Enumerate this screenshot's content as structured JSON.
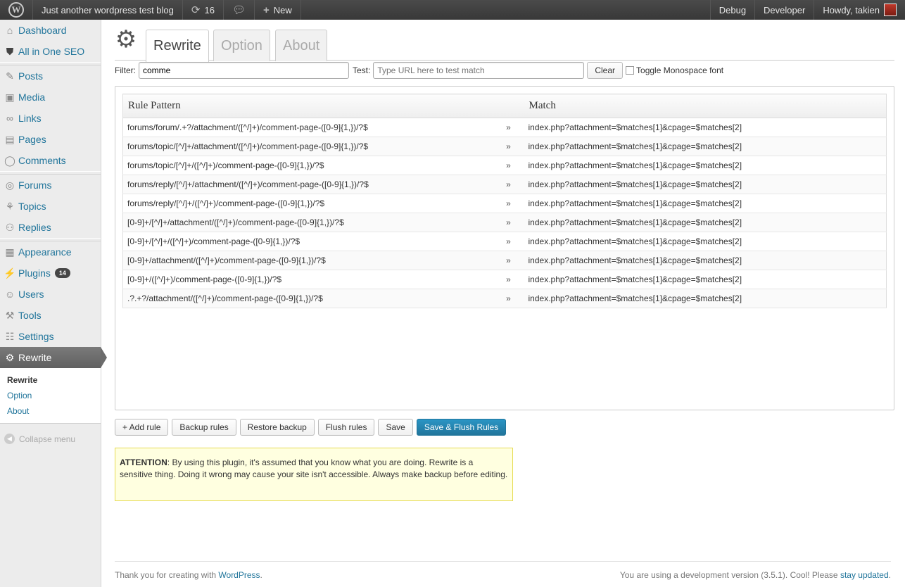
{
  "adminbar": {
    "site_name": "Just another wordpress test blog",
    "updates_count": "16",
    "new_label": "New",
    "debug_label": "Debug",
    "developer_label": "Developer",
    "howdy_label": "Howdy, takien"
  },
  "sidebar": {
    "items": [
      {
        "label": "Dashboard",
        "icon": "dashboard-icon"
      },
      {
        "label": "All in One SEO",
        "icon": "shield-icon"
      },
      {
        "label": "Posts",
        "icon": "pin-icon"
      },
      {
        "label": "Media",
        "icon": "media-icon"
      },
      {
        "label": "Links",
        "icon": "link-icon"
      },
      {
        "label": "Pages",
        "icon": "pages-icon"
      },
      {
        "label": "Comments",
        "icon": "comment-icon"
      },
      {
        "label": "Forums",
        "icon": "forum-icon"
      },
      {
        "label": "Topics",
        "icon": "topics-icon"
      },
      {
        "label": "Replies",
        "icon": "replies-icon"
      },
      {
        "label": "Appearance",
        "icon": "appearance-icon"
      },
      {
        "label": "Plugins",
        "icon": "plugin-icon",
        "badge": "14"
      },
      {
        "label": "Users",
        "icon": "users-icon"
      },
      {
        "label": "Tools",
        "icon": "tools-icon"
      },
      {
        "label": "Settings",
        "icon": "settings-icon"
      },
      {
        "label": "Rewrite",
        "icon": "gear-icon"
      }
    ],
    "submenu": [
      "Rewrite",
      "Option",
      "About"
    ],
    "collapse_label": "Collapse menu"
  },
  "tabs": [
    "Rewrite",
    "Option",
    "About"
  ],
  "filter": {
    "filter_label": "Filter:",
    "filter_value": "comme",
    "test_label": "Test:",
    "test_placeholder": "Type URL here to test match",
    "clear_label": "Clear",
    "toggle_label": "Toggle Monospace font"
  },
  "table": {
    "headers": [
      "Rule Pattern",
      "Match"
    ],
    "arrow": "»",
    "rows": [
      {
        "pattern": "forums/forum/.+?/attachment/([^/]+)/comment-page-([0-9]{1,})/?$",
        "match": "index.php?attachment=$matches[1]&cpage=$matches[2]"
      },
      {
        "pattern": "forums/topic/[^/]+/attachment/([^/]+)/comment-page-([0-9]{1,})/?$",
        "match": "index.php?attachment=$matches[1]&cpage=$matches[2]"
      },
      {
        "pattern": "forums/topic/[^/]+/([^/]+)/comment-page-([0-9]{1,})/?$",
        "match": "index.php?attachment=$matches[1]&cpage=$matches[2]"
      },
      {
        "pattern": "forums/reply/[^/]+/attachment/([^/]+)/comment-page-([0-9]{1,})/?$",
        "match": "index.php?attachment=$matches[1]&cpage=$matches[2]"
      },
      {
        "pattern": "forums/reply/[^/]+/([^/]+)/comment-page-([0-9]{1,})/?$",
        "match": "index.php?attachment=$matches[1]&cpage=$matches[2]"
      },
      {
        "pattern": "[0-9]+/[^/]+/attachment/([^/]+)/comment-page-([0-9]{1,})/?$",
        "match": "index.php?attachment=$matches[1]&cpage=$matches[2]"
      },
      {
        "pattern": "[0-9]+/[^/]+/([^/]+)/comment-page-([0-9]{1,})/?$",
        "match": "index.php?attachment=$matches[1]&cpage=$matches[2]"
      },
      {
        "pattern": "[0-9]+/attachment/([^/]+)/comment-page-([0-9]{1,})/?$",
        "match": "index.php?attachment=$matches[1]&cpage=$matches[2]"
      },
      {
        "pattern": "[0-9]+/([^/]+)/comment-page-([0-9]{1,})/?$",
        "match": "index.php?attachment=$matches[1]&cpage=$matches[2]"
      },
      {
        "pattern": ".?.+?/attachment/([^/]+)/comment-page-([0-9]{1,})/?$",
        "match": "index.php?attachment=$matches[1]&cpage=$matches[2]"
      }
    ]
  },
  "actions": {
    "add_rule": "+ Add rule",
    "backup_rules": "Backup rules",
    "restore_backup": "Restore backup",
    "flush_rules": "Flush rules",
    "save": "Save",
    "save_flush": "Save & Flush Rules"
  },
  "attention": {
    "title": "ATTENTION",
    "text": ": By using this plugin, it's assumed that you know what you are doing. Rewrite is a sensitive thing. Doing it wrong may cause your site isn't accessible. Always make backup before editing."
  },
  "footer": {
    "left_prefix": "Thank you for creating with ",
    "left_link": "WordPress",
    "left_suffix": ".",
    "right_prefix": "You are using a development version (3.5.1). Cool! Please ",
    "right_link": "stay updated",
    "right_suffix": "."
  }
}
